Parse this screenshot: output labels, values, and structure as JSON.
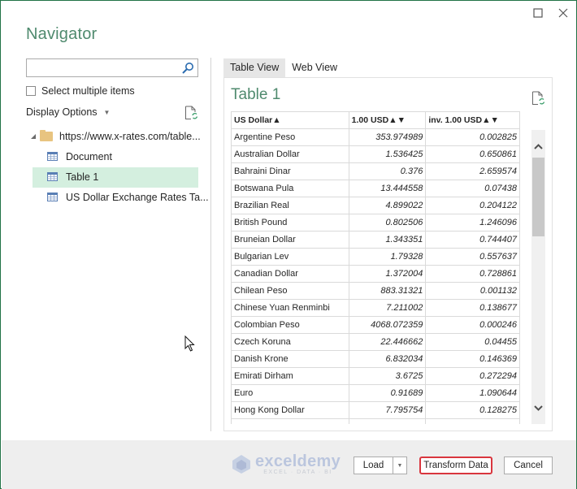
{
  "window": {
    "title": "Navigator",
    "controls": {
      "maximize": "maximize-icon",
      "close": "close-icon"
    }
  },
  "left_pane": {
    "search": {
      "value": "",
      "placeholder": ""
    },
    "select_multiple_label": "Select multiple items",
    "select_multiple_checked": false,
    "display_options_label": "Display Options",
    "tree": {
      "root": {
        "label": "https://www.x-rates.com/table...",
        "icon": "folder-icon",
        "expanded": true
      },
      "items": [
        {
          "label": "Document",
          "icon": "table-icon",
          "selected": false
        },
        {
          "label": "Table 1",
          "icon": "table-icon",
          "selected": true
        },
        {
          "label": "US Dollar Exchange Rates Ta...",
          "icon": "table-icon",
          "selected": false
        }
      ]
    }
  },
  "right_pane": {
    "tabs": [
      {
        "label": "Table View",
        "active": true
      },
      {
        "label": "Web View",
        "active": false
      }
    ],
    "table_title": "Table 1",
    "columns": [
      "US Dollar▲",
      "1.00 USD▲▼",
      "inv. 1.00 USD▲▼"
    ],
    "rows": [
      [
        "Argentine Peso",
        "353.974989",
        "0.002825"
      ],
      [
        "Australian Dollar",
        "1.536425",
        "0.650861"
      ],
      [
        "Bahraini Dinar",
        "0.376",
        "2.659574"
      ],
      [
        "Botswana Pula",
        "13.444558",
        "0.07438"
      ],
      [
        "Brazilian Real",
        "4.899022",
        "0.204122"
      ],
      [
        "British Pound",
        "0.802506",
        "1.246096"
      ],
      [
        "Bruneian Dollar",
        "1.343351",
        "0.744407"
      ],
      [
        "Bulgarian Lev",
        "1.79328",
        "0.557637"
      ],
      [
        "Canadian Dollar",
        "1.372004",
        "0.728861"
      ],
      [
        "Chilean Peso",
        "883.31321",
        "0.001132"
      ],
      [
        "Chinese Yuan Renminbi",
        "7.211002",
        "0.138677"
      ],
      [
        "Colombian Peso",
        "4068.072359",
        "0.000246"
      ],
      [
        "Czech Koruna",
        "22.446662",
        "0.04455"
      ],
      [
        "Danish Krone",
        "6.832034",
        "0.146369"
      ],
      [
        "Emirati Dirham",
        "3.6725",
        "0.272294"
      ],
      [
        "Euro",
        "0.91689",
        "1.090644"
      ],
      [
        "Hong Kong Dollar",
        "7.795754",
        "0.128275"
      ],
      [
        "",
        "",
        ""
      ]
    ]
  },
  "footer": {
    "watermark": {
      "brand": "exceldemy",
      "tagline": "EXCEL · DATA · BI"
    },
    "load_label": "Load",
    "transform_label": "Transform Data",
    "cancel_label": "Cancel"
  },
  "colors": {
    "accent_green": "#4f8a6e",
    "window_border": "#217346",
    "selected_row": "#d4efdf",
    "highlight_red": "#d9363e"
  }
}
